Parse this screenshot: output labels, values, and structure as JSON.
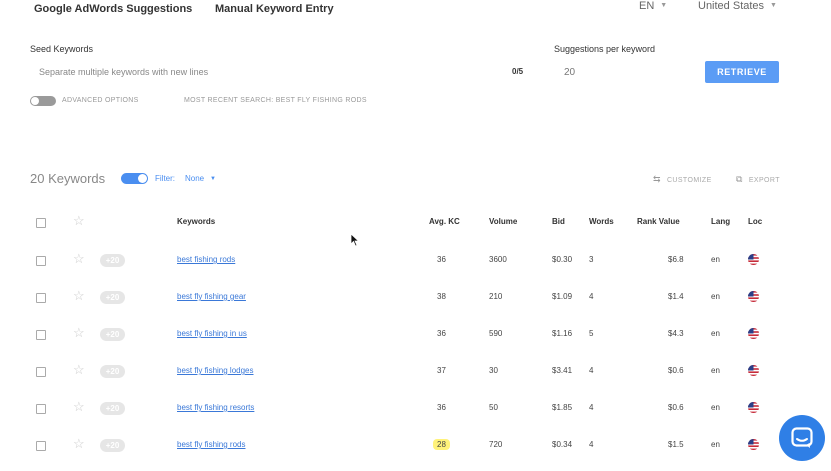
{
  "top_tabs": [
    "Google AdWords Suggestions",
    "Manual Keyword Entry"
  ],
  "language": "EN",
  "country": "United States",
  "seed": {
    "label": "Seed Keywords",
    "placeholder": "Separate multiple keywords with new lines",
    "count": "0/5"
  },
  "suggestions": {
    "label": "Suggestions per keyword",
    "value": "20"
  },
  "retrieve_label": "RETRIEVE",
  "advanced_options_label": "ADVANCED OPTIONS",
  "recent_search_label": "MOST RECENT SEARCH: best fly fishing rods",
  "results": {
    "count_label": "20 Keywords",
    "filter_label": "Filter:",
    "filter_value": "None",
    "customize_label": "CUSTOMIZE",
    "export_label": "EXPORT"
  },
  "columns": [
    "Keywords",
    "Avg. KC",
    "Volume",
    "Bid",
    "Words",
    "Rank Value",
    "Lang",
    "Loc"
  ],
  "rows": [
    {
      "badge": "+20",
      "keyword": "best fishing rods",
      "kc": "36",
      "volume": "3600",
      "bid": "$0.30",
      "words": "3",
      "rank_value": "$6.8",
      "lang": "en",
      "highlight": false
    },
    {
      "badge": "+20",
      "keyword": "best fly fishing gear",
      "kc": "38",
      "volume": "210",
      "bid": "$1.09",
      "words": "4",
      "rank_value": "$1.4",
      "lang": "en",
      "highlight": false
    },
    {
      "badge": "+20",
      "keyword": "best fly fishing in us",
      "kc": "36",
      "volume": "590",
      "bid": "$1.16",
      "words": "5",
      "rank_value": "$4.3",
      "lang": "en",
      "highlight": false
    },
    {
      "badge": "+20",
      "keyword": "best fly fishing lodges",
      "kc": "37",
      "volume": "30",
      "bid": "$3.41",
      "words": "4",
      "rank_value": "$0.6",
      "lang": "en",
      "highlight": false
    },
    {
      "badge": "+20",
      "keyword": "best fly fishing resorts",
      "kc": "36",
      "volume": "50",
      "bid": "$1.85",
      "words": "4",
      "rank_value": "$0.6",
      "lang": "en",
      "highlight": false
    },
    {
      "badge": "+20",
      "keyword": "best fly fishing rods",
      "kc": "28",
      "volume": "720",
      "bid": "$0.34",
      "words": "4",
      "rank_value": "$1.5",
      "lang": "en",
      "highlight": true
    }
  ],
  "colors": {
    "accent": "#5b9cf5",
    "link": "#3a78d8",
    "highlight": "#fff27a",
    "chat": "#2f7fe6"
  },
  "icons": {
    "star": "star-icon",
    "flag": "us-flag-icon",
    "chat": "chat-icon",
    "customize": "sliders-icon",
    "export": "export-icon"
  }
}
